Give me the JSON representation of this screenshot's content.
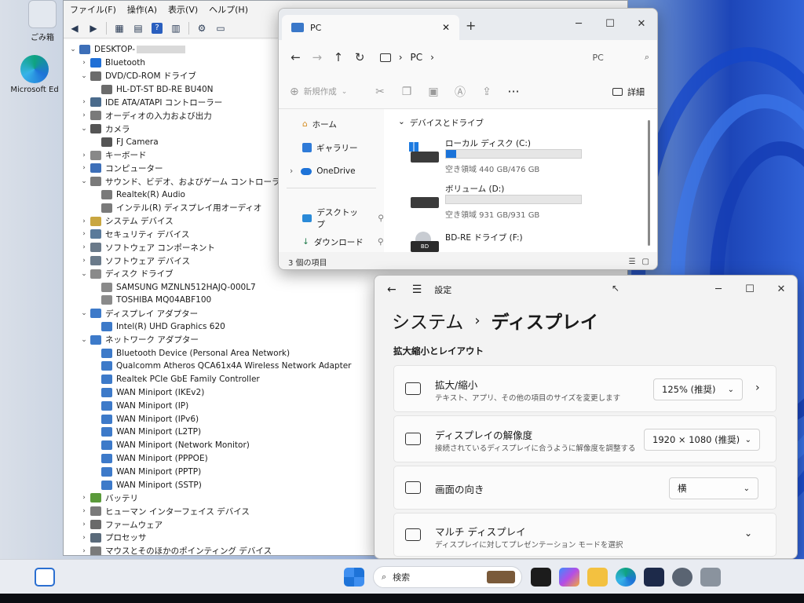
{
  "desktop": {
    "icons": [
      {
        "label": "ごみ箱",
        "icon": "recycle-bin-icon"
      },
      {
        "label": "Microsoft Ed",
        "icon": "edge-icon"
      }
    ]
  },
  "device_manager": {
    "menu": [
      "ファイル(F)",
      "操作(A)",
      "表示(V)",
      "ヘルプ(H)"
    ],
    "root": "DESKTOP-",
    "nodes": [
      {
        "label": "Bluetooth",
        "level": 1,
        "state": "collapsed",
        "icon": "bluetooth-icon"
      },
      {
        "label": "DVD/CD-ROM ドライブ",
        "level": 1,
        "state": "expanded",
        "icon": "disc-drive-icon"
      },
      {
        "label": "HL-DT-ST BD-RE BU40N",
        "level": 2,
        "icon": "disc-drive-icon"
      },
      {
        "label": "IDE ATA/ATAPI コントローラー",
        "level": 1,
        "state": "collapsed",
        "icon": "controller-icon"
      },
      {
        "label": "オーディオの入力および出力",
        "level": 1,
        "state": "collapsed",
        "icon": "speaker-icon"
      },
      {
        "label": "カメラ",
        "level": 1,
        "state": "expanded",
        "icon": "camera-icon"
      },
      {
        "label": "FJ Camera",
        "level": 2,
        "icon": "camera-icon"
      },
      {
        "label": "キーボード",
        "level": 1,
        "state": "collapsed",
        "icon": "keyboard-icon"
      },
      {
        "label": "コンピューター",
        "level": 1,
        "state": "collapsed",
        "icon": "computer-icon"
      },
      {
        "label": "サウンド、ビデオ、およびゲーム コントローラー",
        "level": 1,
        "state": "expanded",
        "icon": "speaker-icon"
      },
      {
        "label": "Realtek(R) Audio",
        "level": 2,
        "icon": "speaker-icon"
      },
      {
        "label": "インテル(R) ディスプレイ用オーディオ",
        "level": 2,
        "icon": "speaker-icon"
      },
      {
        "label": "システム デバイス",
        "level": 1,
        "state": "collapsed",
        "icon": "folder-chip-icon"
      },
      {
        "label": "セキュリティ デバイス",
        "level": 1,
        "state": "collapsed",
        "icon": "security-icon"
      },
      {
        "label": "ソフトウェア コンポーネント",
        "level": 1,
        "state": "collapsed",
        "icon": "component-icon"
      },
      {
        "label": "ソフトウェア デバイス",
        "level": 1,
        "state": "collapsed",
        "icon": "component-icon"
      },
      {
        "label": "ディスク ドライブ",
        "level": 1,
        "state": "expanded",
        "icon": "disk-icon"
      },
      {
        "label": "SAMSUNG MZNLN512HAJQ-000L7",
        "level": 2,
        "icon": "disk-icon"
      },
      {
        "label": "TOSHIBA MQ04ABF100",
        "level": 2,
        "icon": "disk-icon"
      },
      {
        "label": "ディスプレイ アダプター",
        "level": 1,
        "state": "expanded",
        "icon": "monitor-icon"
      },
      {
        "label": "Intel(R) UHD Graphics 620",
        "level": 2,
        "icon": "monitor-icon"
      },
      {
        "label": "ネットワーク アダプター",
        "level": 1,
        "state": "expanded",
        "icon": "network-icon"
      },
      {
        "label": "Bluetooth Device (Personal Area Network)",
        "level": 2,
        "icon": "network-icon"
      },
      {
        "label": "Qualcomm Atheros QCA61x4A Wireless Network Adapter",
        "level": 2,
        "icon": "network-icon"
      },
      {
        "label": "Realtek PCIe GbE Family Controller",
        "level": 2,
        "icon": "network-icon"
      },
      {
        "label": "WAN Miniport (IKEv2)",
        "level": 2,
        "icon": "network-icon"
      },
      {
        "label": "WAN Miniport (IP)",
        "level": 2,
        "icon": "network-icon"
      },
      {
        "label": "WAN Miniport (IPv6)",
        "level": 2,
        "icon": "network-icon"
      },
      {
        "label": "WAN Miniport (L2TP)",
        "level": 2,
        "icon": "network-icon"
      },
      {
        "label": "WAN Miniport (Network Monitor)",
        "level": 2,
        "icon": "network-icon"
      },
      {
        "label": "WAN Miniport (PPPOE)",
        "level": 2,
        "icon": "network-icon"
      },
      {
        "label": "WAN Miniport (PPTP)",
        "level": 2,
        "icon": "network-icon"
      },
      {
        "label": "WAN Miniport (SSTP)",
        "level": 2,
        "icon": "network-icon"
      },
      {
        "label": "バッテリ",
        "level": 1,
        "state": "collapsed",
        "icon": "battery-icon"
      },
      {
        "label": "ヒューマン インターフェイス デバイス",
        "level": 1,
        "state": "collapsed",
        "icon": "hid-icon"
      },
      {
        "label": "ファームウェア",
        "level": 1,
        "state": "collapsed",
        "icon": "firmware-icon"
      },
      {
        "label": "プロセッサ",
        "level": 1,
        "state": "collapsed",
        "icon": "processor-icon"
      },
      {
        "label": "マウスとそのほかのポインティング デバイス",
        "level": 1,
        "state": "collapsed",
        "icon": "mouse-icon"
      }
    ]
  },
  "explorer": {
    "tab_title": "PC",
    "breadcrumb": "PC",
    "search_placeholder": "PC",
    "new_label": "新規作成",
    "details_label": "詳細",
    "sidebar": [
      {
        "label": "ホーム",
        "icon": "home-icon"
      },
      {
        "label": "ギャラリー",
        "icon": "gallery-icon"
      },
      {
        "label": "OneDrive",
        "icon": "onedrive-icon"
      },
      {
        "label": "デスクトップ",
        "icon": "desktop-folder-icon"
      },
      {
        "label": "ダウンロード",
        "icon": "download-icon"
      }
    ],
    "section_header": "デバイスとドライブ",
    "drives": [
      {
        "name": "ローカル ディスク (C:)",
        "free": "空き領域 440 GB/476 GB",
        "used_fraction": 0.076,
        "icon": "windows-drive-icon"
      },
      {
        "name": "ボリューム (D:)",
        "free": "空き領域 931 GB/931 GB",
        "used_fraction": 0.0,
        "icon": "hard-drive-icon"
      },
      {
        "name": "BD-RE ドライブ (F:)",
        "badge": "BD",
        "icon": "bd-drive-icon"
      }
    ],
    "status": "3 個の項目"
  },
  "settings": {
    "app_title": "設定",
    "breadcrumb_parent": "システム",
    "breadcrumb_sep": "›",
    "breadcrumb_current": "ディスプレイ",
    "section": "拡大縮小とレイアウト",
    "rows": [
      {
        "title": "拡大/縮小",
        "subtitle": "テキスト、アプリ、その他の項目のサイズを変更します",
        "value": "125% (推奨)",
        "icon": "scale-icon"
      },
      {
        "title": "ディスプレイの解像度",
        "subtitle": "接続されているディスプレイに合うように解像度を調整する",
        "value": "1920 × 1080 (推奨)",
        "icon": "resolution-icon"
      },
      {
        "title": "画面の向き",
        "subtitle": "",
        "value": "横",
        "icon": "orientation-icon"
      },
      {
        "title": "マルチ ディスプレイ",
        "subtitle": "ディスプレイに対してプレゼンテーション モードを選択",
        "value": "",
        "icon": "multi-display-icon"
      }
    ]
  },
  "taskbar": {
    "search_placeholder": "検索",
    "apps": [
      "widgets-icon",
      "start-icon",
      "taskview-icon",
      "copilot-icon",
      "file-explorer-icon",
      "edge-icon",
      "store-icon",
      "settings-icon",
      "device-manager-icon"
    ]
  },
  "colors": {
    "accent": "#1a73d9",
    "wallpaper": "#1d46b8"
  }
}
